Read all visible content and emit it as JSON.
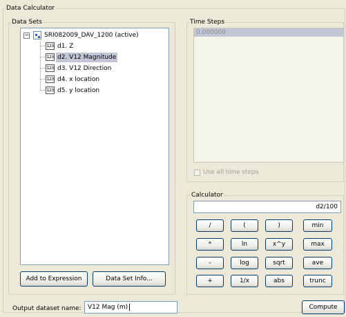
{
  "window": {
    "title": "Data Calculator"
  },
  "data_sets": {
    "title": "Data Sets",
    "root": {
      "label": "SRI082009_DAV_1200 (active)",
      "toggle": "−"
    },
    "items": [
      {
        "badge": "123",
        "label": "d1. Z"
      },
      {
        "badge": "123",
        "label": "d2. V12 Magnitude",
        "selected": true
      },
      {
        "badge": "123",
        "label": "d3. V12 Direction"
      },
      {
        "badge": "123",
        "label": "d4. x location"
      },
      {
        "badge": "123",
        "label": "d5. y location"
      }
    ],
    "add_button": "Add to Expression",
    "info_button": "Data Set Info..."
  },
  "time_steps": {
    "title": "Time Steps",
    "items": [
      "0.000000"
    ],
    "use_all_label": "Use all time steps",
    "use_all_checked": false
  },
  "calculator": {
    "title": "Calculator",
    "expression": "d2/100",
    "keys": [
      [
        "/",
        "(",
        ")",
        "min"
      ],
      [
        "*",
        "ln",
        "x^y",
        "max"
      ],
      [
        "-",
        "log",
        "sqrt",
        "ave"
      ],
      [
        "+",
        "1/x",
        "abs",
        "trunc"
      ]
    ]
  },
  "output": {
    "label": "Output dataset name:",
    "value": "V12 Mag (m)"
  },
  "compute_button": "Compute",
  "colors": {
    "selection": "#c1c7d6",
    "border": "#7f9db9",
    "button_border": "#003c74"
  }
}
